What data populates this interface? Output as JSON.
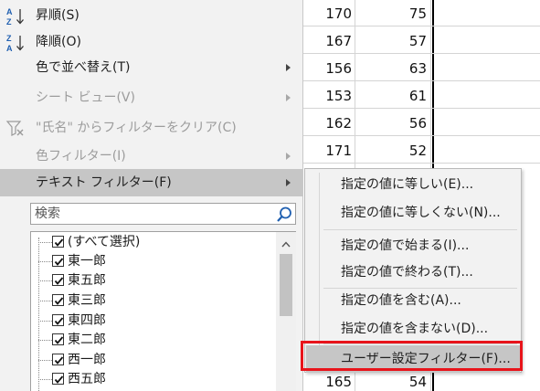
{
  "sheet": {
    "rows": [
      {
        "a": "170",
        "b": "75"
      },
      {
        "a": "167",
        "b": "57"
      },
      {
        "a": "156",
        "b": "63"
      },
      {
        "a": "153",
        "b": "61"
      },
      {
        "a": "162",
        "b": "56"
      },
      {
        "a": "171",
        "b": "52"
      }
    ],
    "partial": {
      "a": "165",
      "b": "54"
    }
  },
  "menu": {
    "sort_asc": "昇順(S)",
    "sort_desc": "降順(O)",
    "sort_by_color": "色で並べ替え(T)",
    "sheet_view": "シート ビュー(V)",
    "clear_filter": "\"氏名\" からフィルターをクリア(C)",
    "color_filter": "色フィルター(I)",
    "text_filter": "テキスト フィルター(F)"
  },
  "search": {
    "placeholder": "検索"
  },
  "filter_list": [
    "(すべて選択)",
    "東一郎",
    "東五郎",
    "東三郎",
    "東四郎",
    "東二郎",
    "西一郎",
    "西五郎"
  ],
  "submenu": {
    "equals": "指定の値に等しい(E)...",
    "not_equals": "指定の値に等しくない(N)...",
    "begins_with": "指定の値で始まる(I)...",
    "ends_with": "指定の値で終わる(T)...",
    "contains": "指定の値を含む(A)...",
    "not_contains": "指定の値を含まない(D)...",
    "custom": "ユーザー設定フィルター(F)..."
  },
  "colors": {
    "highlight": "#c6c6c6",
    "annotation": "#e8141b",
    "menu_bg": "#f2f2f2"
  }
}
